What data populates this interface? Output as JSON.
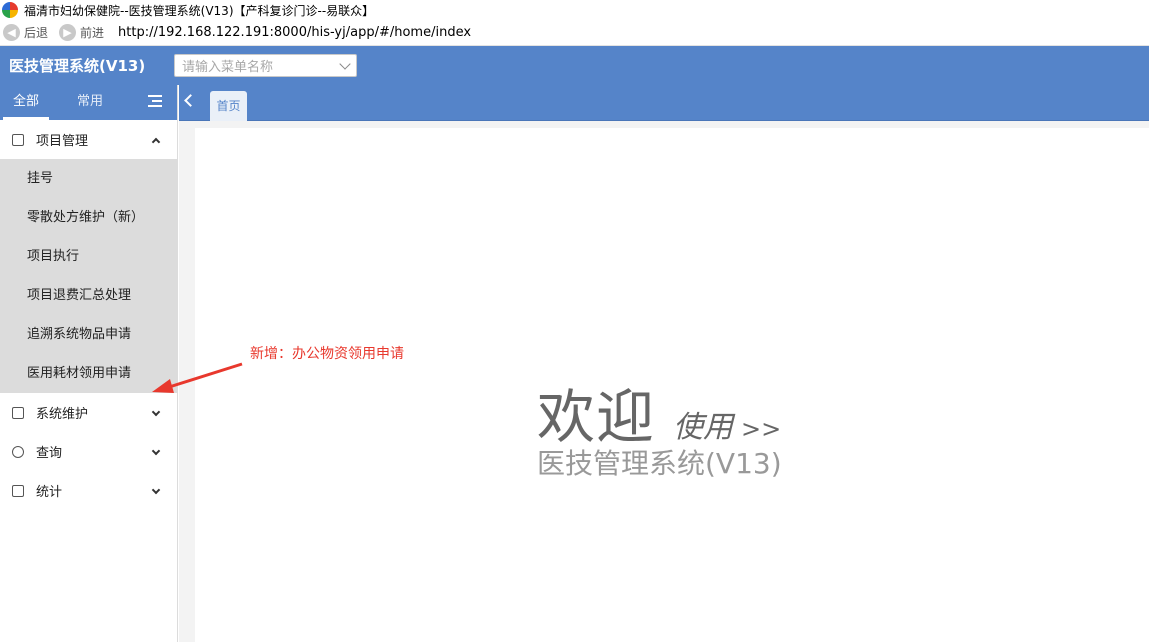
{
  "window": {
    "title": "福清市妇幼保健院--医技管理系统(V13)【产科复诊门诊--易联众】"
  },
  "navbar": {
    "back_label": "后退",
    "forward_label": "前进",
    "url": "http://192.168.122.191:8000/his-yj/app/#/home/index"
  },
  "header": {
    "system_title": "医技管理系统(V13)",
    "menu_search_placeholder": "请输入菜单名称"
  },
  "sidebar": {
    "tabs": [
      {
        "label": "全部",
        "active": true
      },
      {
        "label": "常用",
        "active": false
      }
    ],
    "groups": [
      {
        "label": "项目管理",
        "icon": "project-icon",
        "expanded": true,
        "items": [
          "挂号",
          "零散处方维护（新）",
          "项目执行",
          "项目退费汇总处理",
          "追溯系统物品申请",
          "医用耗材领用申请"
        ]
      },
      {
        "label": "系统维护",
        "icon": "monitor-icon",
        "expanded": false
      },
      {
        "label": "查询",
        "icon": "query-icon",
        "expanded": false
      },
      {
        "label": "统计",
        "icon": "stats-icon",
        "expanded": false
      }
    ]
  },
  "tabs": {
    "home_label": "首页"
  },
  "welcome": {
    "big": "欢迎",
    "use": "使用",
    "arrow": ">>",
    "subtitle": "医技管理系统(V13)"
  },
  "annotation": {
    "text": "新增：办公物资领用申请",
    "color": "#e8382d"
  },
  "colors": {
    "primary": "#5584c9",
    "submenu_bg": "#dcdcdc"
  }
}
